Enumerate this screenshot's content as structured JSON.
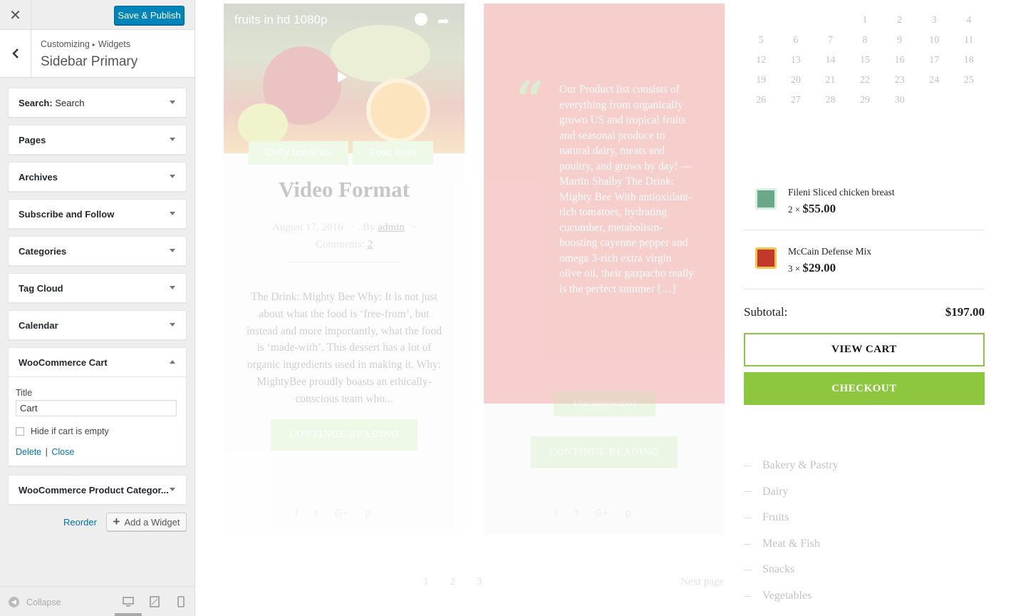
{
  "customizer": {
    "close_glyph": "✕",
    "save_label": "Save & Publish",
    "breadcrumb": {
      "root": "Customizing",
      "sep": "▸",
      "leaf": "Widgets"
    },
    "section_title": "Sidebar Primary",
    "widgets": [
      {
        "name": "Search:",
        "subtitle": "Search",
        "expanded": false
      },
      {
        "name": "Pages",
        "subtitle": "",
        "expanded": false
      },
      {
        "name": "Archives",
        "subtitle": "",
        "expanded": false
      },
      {
        "name": "Subscribe and Follow",
        "subtitle": "",
        "expanded": false
      },
      {
        "name": "Categories",
        "subtitle": "",
        "expanded": false
      },
      {
        "name": "Tag Cloud",
        "subtitle": "",
        "expanded": false
      },
      {
        "name": "Calendar",
        "subtitle": "",
        "expanded": false
      },
      {
        "name": "WooCommerce Cart",
        "subtitle": "",
        "expanded": true
      },
      {
        "name": "WooCommerce Product Categor...",
        "subtitle": "",
        "expanded": false
      }
    ],
    "cart_widget_form": {
      "title_label": "Title",
      "title_value": "Cart",
      "hide_label": "Hide if cart is empty",
      "hide_checked": false,
      "delete_label": "Delete",
      "separator": "|",
      "close_label": "Close"
    },
    "reorder_label": "Reorder",
    "add_widget_label": "Add a Widget",
    "collapse_label": "Collapse",
    "accent": "#0085ba"
  },
  "preview": {
    "post1": {
      "video_title": "fruits in hd 1080p",
      "tags": [
        "Daily breakfast",
        "Food ideas"
      ],
      "title": "Video Format",
      "date": "August 17, 2016",
      "by_label": "By",
      "author": "admin",
      "comments_label": "Comments:",
      "comments_count": "2",
      "excerpt": "The Drink: Mighty Bee Why: It is not just about what the food is ‘free-from’, but instead and more importantly, what the food is ‘made-with’. This dessert has a lot of organic ingredients used in making it. Why: MightyBee proudly boasts an ethically-conscious team who...",
      "continue_label": "CONTINUE READING"
    },
    "post2": {
      "quote_glyph": "“",
      "quote": "Our Product list consists of everything from organically grown US and tropical fruits and seasonal produce to natural dairy, meats and poultry, and grows by day! — Martin Shalby The Drink: Mighty Bee With antioxidant-rich tomatoes, hydrating cucumber, metabolism-boosting cayenne pepper and omega 3-rich extra virgin olive oil, their gazpacho really is the perfect summer […]",
      "category": "Uncategorized",
      "continue_label": "CONTINUE READING"
    },
    "social_icons": [
      "f",
      "t",
      "G+",
      "p"
    ],
    "pagination": [
      "1",
      "2",
      "3"
    ],
    "next_page": "Next page",
    "calendar_rows": [
      [
        "",
        "",
        "",
        "1",
        "2",
        "3",
        "4"
      ],
      [
        "5",
        "6",
        "7",
        "8",
        "9",
        "10",
        "11"
      ],
      [
        "12",
        "13",
        "14",
        "15",
        "16",
        "17",
        "18"
      ],
      [
        "19",
        "20",
        "21",
        "22",
        "23",
        "24",
        "25"
      ],
      [
        "26",
        "27",
        "28",
        "29",
        "30",
        "",
        ""
      ]
    ],
    "cart": {
      "items": [
        {
          "name": "Fileni Sliced chicken breast",
          "qty": "2",
          "times": "×",
          "price": "$55.00",
          "thumb_color": "#6aa88a"
        },
        {
          "name": "McCain Defense Mix",
          "qty": "3",
          "times": "×",
          "price": "$29.00",
          "thumb_color": "#c0392b"
        }
      ],
      "subtotal_label": "Subtotal:",
      "subtotal_value": "$197.00",
      "view_cart_label": "VIEW CART",
      "checkout_label": "CHECKOUT",
      "accent_green": "#8dc63f"
    },
    "categories": [
      "Bakery & Pastry",
      "Dairy",
      "Fruits",
      "Meat & Fish",
      "Snacks",
      "Vegetables"
    ]
  }
}
